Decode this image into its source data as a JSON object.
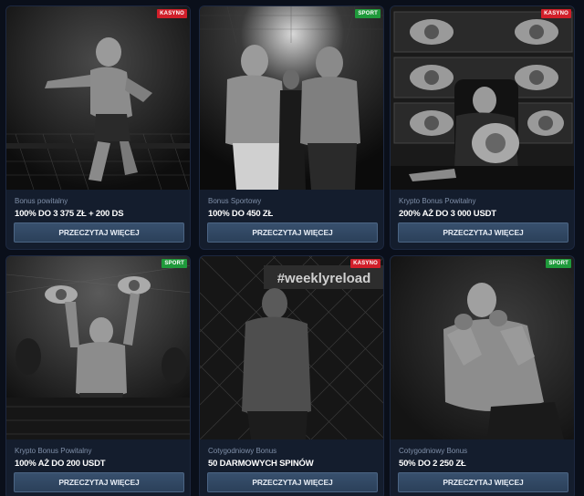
{
  "cards": [
    {
      "badge": "KASYNO",
      "badge_color": "#d11f2a",
      "subtitle": "Bonus powitalny",
      "offer": "100% DO 3 375 ZŁ + 200 DS",
      "cta": "PRZECZYTAJ WIĘCEJ",
      "image": "fighter-celebrating-on-cage-photo"
    },
    {
      "badge": "SPORT",
      "badge_color": "#1f9a3b",
      "subtitle": "Bonus Sportowy",
      "offer": "100% DO 450 ZŁ",
      "cta": "PRZECZYTAJ WIĘCEJ",
      "image": "fighters-faceoff-photo"
    },
    {
      "badge": "KASYNO",
      "badge_color": "#d11f2a",
      "subtitle": "Krypto Bonus Powitalny",
      "offer": "200% AŻ DO 3 000 USDT",
      "cta": "PRZECZYTAJ WIĘCEJ",
      "image": "fighter-with-crypto-belts-photo"
    },
    {
      "badge": "SPORT",
      "badge_color": "#1f9a3b",
      "subtitle": "Krypto Bonus Powitalny",
      "offer": "100% AŻ DO 200 USDT",
      "cta": "PRZECZYTAJ WIĘCEJ",
      "image": "champion-holding-belts-photo"
    },
    {
      "badge": "KASYNO",
      "badge_color": "#d11f2a",
      "subtitle": "Cotygodniowy Bonus",
      "offer": "50 DARMOWYCH SPINÓW",
      "cta": "PRZECZYTAJ WIĘCEJ",
      "image": "fighter-weekly-reload-photo"
    },
    {
      "badge": "SPORT",
      "badge_color": "#1f9a3b",
      "subtitle": "Cotygodniowy Bonus",
      "offer": "50% DO 2 250 ZŁ",
      "cta": "PRZECZYTAJ WIĘCEJ",
      "image": "fighter-guard-stance-photo"
    }
  ],
  "banner_text": "#weeklyreload"
}
